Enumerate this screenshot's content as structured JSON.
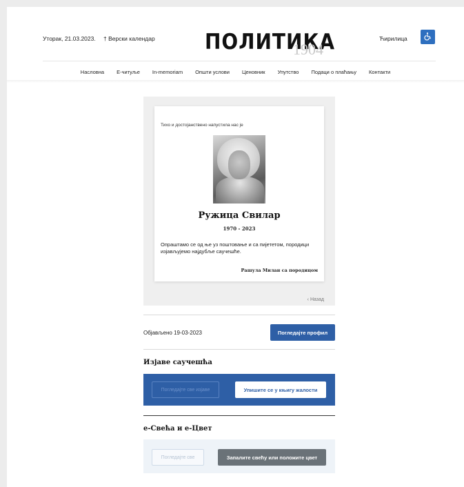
{
  "header": {
    "date": "Уторак, 21.03.2023.",
    "calendar_link": "† Верски календар",
    "logo": "ПОЛИТИКА",
    "logo_year": "1904",
    "script_switch": "Ћирилица",
    "accessibility_icon": "wheelchair-icon"
  },
  "nav": {
    "items": [
      "Насловна",
      "Е-читуље",
      "In-memoriam",
      "Општи услови",
      "Ценовник",
      "Упутство",
      "Подаци о плаћању",
      "Контакти"
    ]
  },
  "obituary": {
    "intro": "Тихо и достојанствено напустила нас је",
    "name": "Ружица Свилар",
    "years": "1970 - 2023",
    "message": "Опраштамо се од ње уз поштовање и са пијететом, породици изјављујемо најдубље саучешће.",
    "signature": "Рашула Милан са породицом",
    "back_label": "Назад"
  },
  "meta": {
    "published": "Објављено 19-03-2023",
    "profile_button": "Погледајте профил"
  },
  "condolences": {
    "title": "Изјаве саучешћа",
    "view_all": "Погледајте све изјаве",
    "sign_book": "Упишите се у књигу жалости"
  },
  "candles": {
    "title": "е-Свећа и е-Цвет",
    "view_all": "Погледајте све",
    "light_candle": "Запалите свећу или положите цвет"
  },
  "colors": {
    "accent": "#2e5fa6",
    "panel_grey": "#efefef",
    "dark_button": "#6a7278"
  }
}
